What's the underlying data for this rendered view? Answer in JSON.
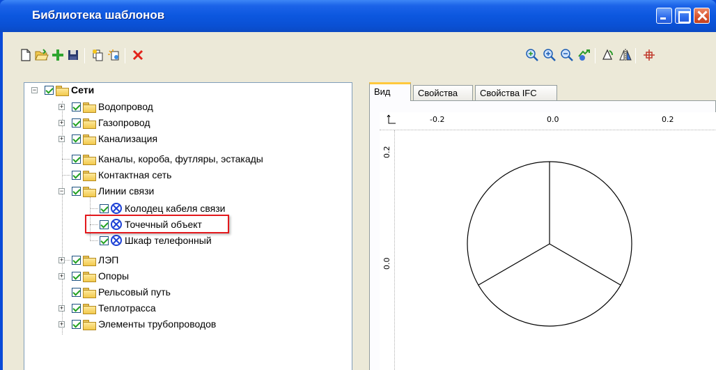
{
  "window": {
    "title": "Библиотека шаблонов",
    "colors": {
      "title_bar": "#0a50d4",
      "client": "#ece9d8",
      "highlight": "#e3181c",
      "check": "#21a121",
      "icon_blue": "#1d41d6"
    }
  },
  "toolbar": {
    "left_icons": [
      "new-document-icon",
      "open-folder-icon",
      "add-plus-icon",
      "save-icon",
      "copy-icon",
      "paste-icon",
      "delete-x-icon"
    ],
    "right_icons": [
      "zoom-extents-icon",
      "zoom-in-icon",
      "zoom-out-icon",
      "pan-hand-icon",
      "rotate-icon",
      "mirror-icon",
      "snap-icon"
    ]
  },
  "tree": {
    "root": {
      "label": "Сети",
      "expanded": true,
      "checked": true
    },
    "items": [
      {
        "label": "Водопровод",
        "checked": true,
        "expandable": true
      },
      {
        "label": "Газопровод",
        "checked": true,
        "expandable": true
      },
      {
        "label": "Канализация",
        "checked": true,
        "expandable": true
      },
      {
        "label": "Каналы, короба, футляры, эстакады",
        "checked": true,
        "expandable": false
      },
      {
        "label": "Контактная сеть",
        "checked": true,
        "expandable": false
      },
      {
        "label": "Линии связи",
        "checked": true,
        "expandable": true,
        "expanded": true,
        "children": [
          {
            "label": "Колодец кабеля связи",
            "checked": true
          },
          {
            "label": "Точечный объект",
            "checked": true,
            "selected": true
          },
          {
            "label": "Шкаф телефонный",
            "checked": true
          }
        ]
      },
      {
        "label": "ЛЭП",
        "checked": true,
        "expandable": true
      },
      {
        "label": "Опоры",
        "checked": true,
        "expandable": true
      },
      {
        "label": "Рельсовый путь",
        "checked": true,
        "expandable": false
      },
      {
        "label": "Теплотрасса",
        "checked": true,
        "expandable": true
      },
      {
        "label": "Элементы трубопроводов",
        "checked": true,
        "expandable": true
      }
    ]
  },
  "tabs": [
    {
      "label": "Вид",
      "active": true
    },
    {
      "label": "Свойства",
      "active": false
    },
    {
      "label": "Свойства IFC",
      "active": false
    }
  ],
  "preview": {
    "ruler_x": [
      "-0.2",
      "0.0",
      "0.2"
    ],
    "ruler_y": [
      "0.2",
      "0.0"
    ],
    "axis_icon": "axis-icon"
  }
}
